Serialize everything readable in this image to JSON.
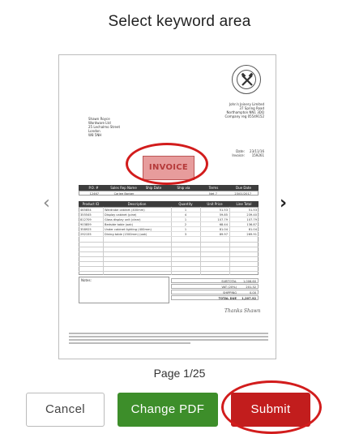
{
  "header": {
    "title": "Select keyword area"
  },
  "nav": {
    "prev_glyph": "‹",
    "next_glyph": "›",
    "prev_icon": "chevron-left-icon",
    "next_icon": "chevron-right-icon"
  },
  "document": {
    "company": {
      "name": "John's Joinery Limited",
      "address_lines": [
        "37 Spring Road",
        "Northampton NN1 3DQ",
        "Company reg 05549152"
      ]
    },
    "recipient": {
      "lines": [
        "Shawn Royce",
        "Wordware Ltd",
        "25 Lechalmo Street",
        "London",
        "W8 5NH"
      ]
    },
    "meta": {
      "date_label": "Date:",
      "date_value": "23/11/16",
      "invoice_label": "Invoice:",
      "invoice_value": "159261"
    },
    "keyword_label": "INVOICE",
    "order_table": {
      "headers": [
        "P.O. #",
        "Sales Rep Name",
        "Ship Date",
        "Ship via",
        "Terms",
        "Due Date"
      ],
      "row": [
        "12467",
        "Carlee Barber",
        "",
        "",
        "Net 7",
        "23/01/2017"
      ]
    },
    "items_table": {
      "headers": [
        "Product ID",
        "Description",
        "Quantity",
        "Unit Price",
        "Line Total"
      ],
      "rows": [
        [
          "465854",
          "Wardrobe cabinet (400mm)",
          "1",
          "51.53",
          "51.53"
        ],
        [
          "355545",
          "Display cabinet (pine)",
          "4",
          "59.85",
          "239.40"
        ],
        [
          "812709",
          "Glass display unit (clear)",
          "1",
          "107.79",
          "107.79"
        ],
        [
          "903859",
          "Bedside table (oak)",
          "2",
          "68.44",
          "136.87"
        ],
        [
          "358925",
          "Under cabinet lighting (400mm)",
          "1",
          "81.04",
          "81.04"
        ],
        [
          "292155",
          "Dining table (1500mm) (oak)",
          "3",
          "89.97",
          "269.91"
        ]
      ],
      "notes_label": "Notes:",
      "totals": [
        {
          "label": "SUBTOTAL",
          "value": "1,006.60"
        },
        {
          "label": "VAT (20%)",
          "value": "201.32"
        },
        {
          "label": "SHIPPING",
          "value": "0.00"
        },
        {
          "label": "TOTAL DUE",
          "value": "1,207.92"
        }
      ]
    },
    "signature": "Thanks Shawn"
  },
  "pager": {
    "text": "Page 1/25"
  },
  "actions": {
    "cancel_label": "Cancel",
    "change_label": "Change PDF",
    "submit_label": "Submit"
  },
  "colors": {
    "change_green": "#3d8e2a",
    "submit_red": "#c21d1d",
    "highlight_ring": "#d21c1c",
    "invoice_box": "#e79c9c"
  }
}
